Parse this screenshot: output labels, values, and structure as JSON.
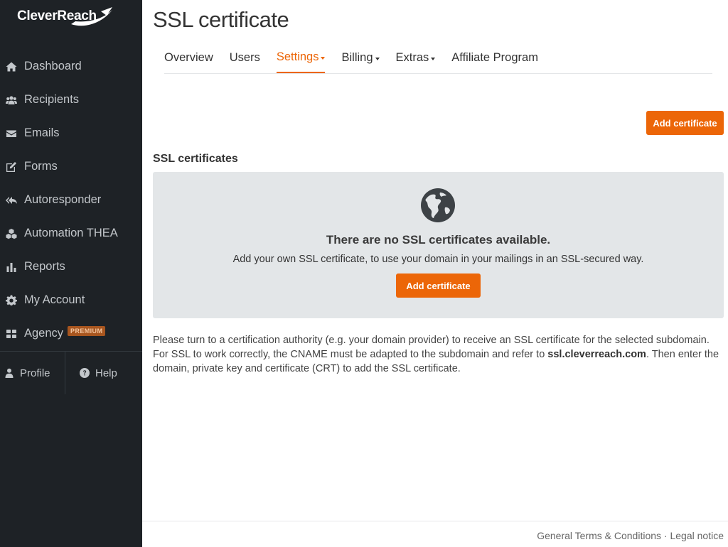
{
  "brand": {
    "name": "CleverReach",
    "accent": "#ec6608",
    "sidebar_bg": "#1e2226"
  },
  "sidebar": {
    "items": [
      {
        "label": "Dashboard",
        "icon": "home-icon"
      },
      {
        "label": "Recipients",
        "icon": "users-icon"
      },
      {
        "label": "Emails",
        "icon": "envelope-icon"
      },
      {
        "label": "Forms",
        "icon": "edit-icon"
      },
      {
        "label": "Autoresponder",
        "icon": "reply-all-icon"
      },
      {
        "label": "Automation THEA",
        "icon": "cubes-icon"
      },
      {
        "label": "Reports",
        "icon": "bar-chart-icon"
      },
      {
        "label": "My Account",
        "icon": "gear-icon"
      },
      {
        "label": "Agency",
        "icon": "grid-icon",
        "badge": "PREMIUM"
      }
    ],
    "footer": {
      "profile": {
        "label": "Profile",
        "icon": "user-icon"
      },
      "help": {
        "label": "Help",
        "icon": "question-circle-icon"
      }
    }
  },
  "page": {
    "title": "SSL certificate"
  },
  "tabs": [
    {
      "label": "Overview",
      "active": false,
      "dropdown": false
    },
    {
      "label": "Users",
      "active": false,
      "dropdown": false
    },
    {
      "label": "Settings",
      "active": true,
      "dropdown": true
    },
    {
      "label": "Billing",
      "active": false,
      "dropdown": true
    },
    {
      "label": "Extras",
      "active": false,
      "dropdown": true
    },
    {
      "label": "Affiliate Program",
      "active": false,
      "dropdown": false
    }
  ],
  "toolbar": {
    "add_label": "Add certificate"
  },
  "certificates": {
    "section_title": "SSL certificates",
    "empty_icon": "globe-icon",
    "empty_title": "There are no SSL certificates available.",
    "empty_text": "Add your own SSL certificate, to use your domain in your mailings in an SSL-secured way.",
    "add_label": "Add certificate"
  },
  "info": {
    "text_before": "Please turn to a certification authority (e.g. your domain provider) to receive an SSL certificate for the selected subdomain. For SSL to work correctly, the CNAME must be adapted to the subdomain and refer to ",
    "domain": "ssl.cleverreach.com",
    "text_after": ". Then enter the domain, private key and certificate (CRT) to add the SSL certificate."
  },
  "footer": {
    "terms": "General Terms & Conditions",
    "separator": "·",
    "legal": "Legal notice"
  }
}
